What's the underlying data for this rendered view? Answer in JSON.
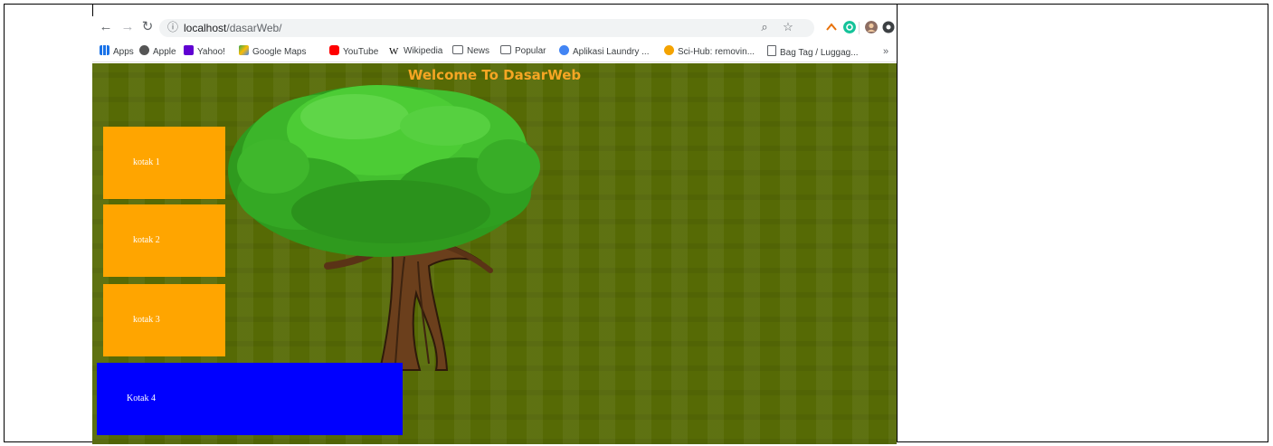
{
  "browser": {
    "url_host": "localhost",
    "url_path": "/dasarWeb/",
    "bookmarks": [
      {
        "label": "Apps",
        "icon": "apps-grid-icon",
        "color": "#1a73e8"
      },
      {
        "label": "Apple",
        "icon": "apple-icon",
        "color": "#555555"
      },
      {
        "label": "Yahoo!",
        "icon": "yahoo-icon",
        "color": "#6001d2"
      },
      {
        "label": "Google Maps",
        "icon": "google-maps-icon",
        "color": "#34a853"
      },
      {
        "label": "YouTube",
        "icon": "youtube-icon",
        "color": "#ff0000"
      },
      {
        "label": "Wikipedia",
        "icon": "wikipedia-icon",
        "color": "#000000"
      },
      {
        "label": "News",
        "icon": "folder-icon",
        "color": "#5f6368"
      },
      {
        "label": "Popular",
        "icon": "folder-icon",
        "color": "#5f6368"
      },
      {
        "label": "Aplikasi Laundry ...",
        "icon": "app-icon",
        "color": "#4285f4"
      },
      {
        "label": "Sci-Hub: removin...",
        "icon": "scihub-icon",
        "color": "#f4a300"
      },
      {
        "label": "Bag Tag / Luggag...",
        "icon": "page-icon",
        "color": "#5f6368"
      }
    ],
    "more_label": "»"
  },
  "page": {
    "title": "Welcome To DasarWeb",
    "boxes": [
      {
        "label": "kotak 1",
        "color": "#ffa500"
      },
      {
        "label": "kotak 2",
        "color": "#ffa500"
      },
      {
        "label": "kotak 3",
        "color": "#ffa500"
      },
      {
        "label": "Kotak 4",
        "color": "#0000ff"
      }
    ],
    "background_color": "#566a05",
    "title_color": "#f5a623"
  }
}
